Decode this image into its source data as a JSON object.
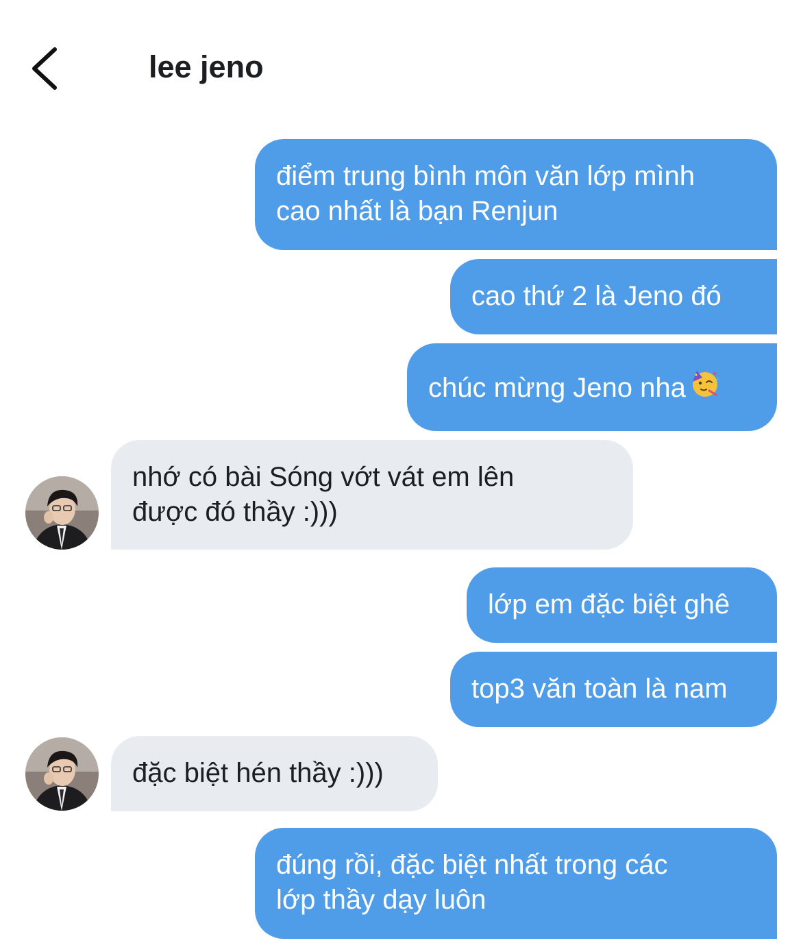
{
  "header": {
    "back_icon": "chevron-left-icon",
    "title": "lee jeno"
  },
  "colors": {
    "sent_bubble": "#4f9de8",
    "received_bubble": "#e8ebef",
    "sent_text": "#ffffff",
    "received_text": "#1c1e21"
  },
  "messages": [
    {
      "direction": "sent",
      "lines": [
        "điểm trung bình môn văn lớp mình",
        "cao nhất là bạn Renjun"
      ]
    },
    {
      "direction": "sent",
      "lines": [
        "cao thứ 2 là Jeno đó"
      ]
    },
    {
      "direction": "sent",
      "lines": [
        "chúc mừng Jeno nha"
      ],
      "emoji": "partying-face-icon"
    },
    {
      "direction": "received",
      "lines": [
        "nhớ có bài Sóng vớt vát em lên",
        "được đó thầy :)))"
      ],
      "avatar": "avatar"
    },
    {
      "direction": "sent",
      "lines": [
        "lớp em đặc biệt ghê"
      ]
    },
    {
      "direction": "sent",
      "lines": [
        "top3 văn toàn là nam"
      ]
    },
    {
      "direction": "received",
      "lines": [
        "đặc biệt hén thầy :)))"
      ],
      "avatar": "avatar"
    },
    {
      "direction": "sent",
      "lines": [
        "đúng rồi, đặc biệt nhất trong các",
        "lớp thầy dạy luôn"
      ]
    }
  ]
}
